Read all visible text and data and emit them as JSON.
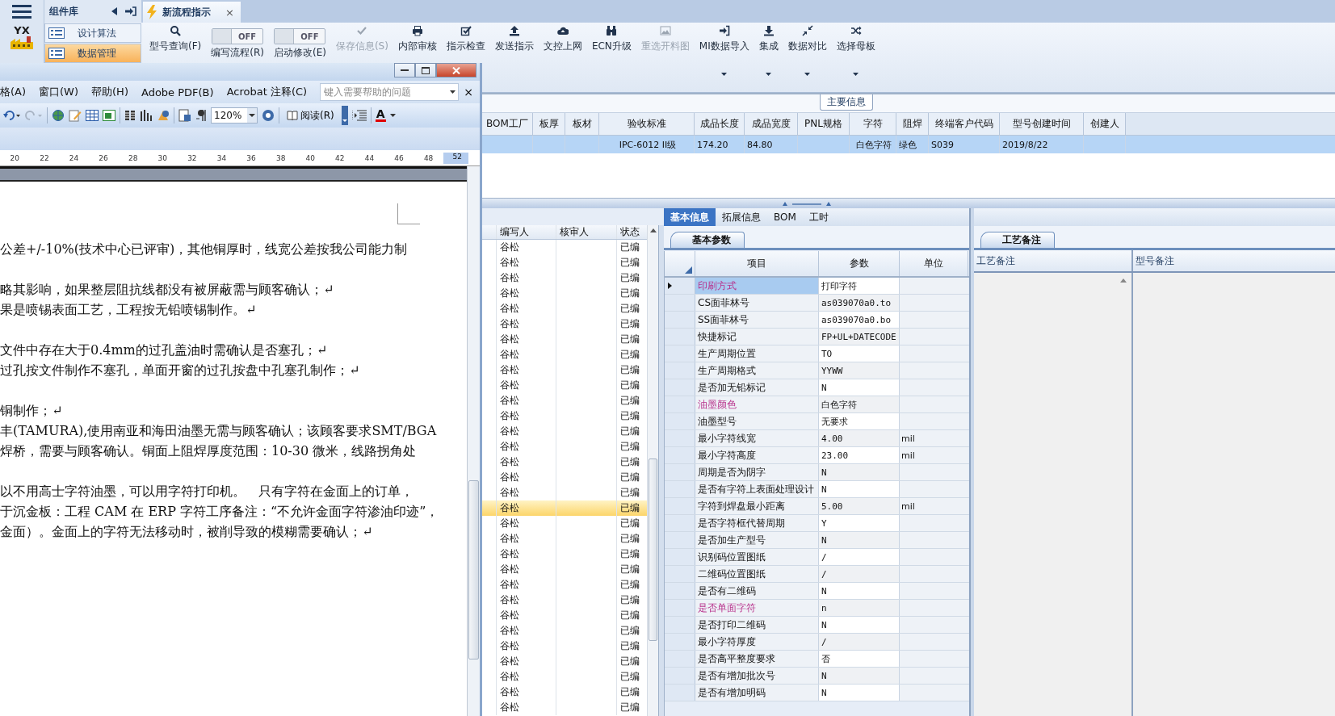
{
  "left_nav": {
    "logo_text": "YX"
  },
  "component_sidebar": {
    "title": "组件库",
    "items": [
      {
        "label": "设计算法",
        "selected": false
      },
      {
        "label": "数据管理",
        "selected": true
      }
    ]
  },
  "document_tabs": [
    {
      "title": "新流程指示",
      "close": "×",
      "selected": true
    }
  ],
  "ribbon": [
    {
      "kind": "button",
      "label": "型号查询(F)",
      "disabled": false,
      "dropdown": false
    },
    {
      "kind": "toggle",
      "label": "编写流程(R)",
      "state_text": "OFF",
      "on": false
    },
    {
      "kind": "toggle",
      "label": "启动修改(E)",
      "state_text": "OFF",
      "on": false
    },
    {
      "kind": "button",
      "label": "保存信息(S)",
      "disabled": true,
      "dropdown": false
    },
    {
      "kind": "button",
      "label": "内部审核",
      "disabled": false,
      "dropdown": false
    },
    {
      "kind": "button",
      "label": "指示检查",
      "disabled": false,
      "dropdown": false
    },
    {
      "kind": "button",
      "label": "发送指示",
      "disabled": false,
      "dropdown": false
    },
    {
      "kind": "button",
      "label": "文控上网",
      "disabled": false,
      "dropdown": false
    },
    {
      "kind": "button",
      "label": "ECN升级",
      "disabled": false,
      "dropdown": false
    },
    {
      "kind": "button",
      "label": "重选开料图",
      "disabled": true,
      "dropdown": false
    },
    {
      "kind": "button",
      "label": "MI数据导入",
      "disabled": false,
      "dropdown": true
    },
    {
      "kind": "button",
      "label": "集成",
      "disabled": false,
      "dropdown": true
    },
    {
      "kind": "button",
      "label": "数据对比",
      "disabled": false,
      "dropdown": true
    },
    {
      "kind": "button",
      "label": "选择母板",
      "disabled": false,
      "dropdown": true
    }
  ],
  "main_group": {
    "title": "主要信息"
  },
  "main_table": {
    "row_selected": true,
    "columns": [
      {
        "label": "BOM工厂"
      },
      {
        "label": "板厚"
      },
      {
        "label": "板材"
      },
      {
        "label": "验收标准",
        "value": "IPC-6012 II级"
      },
      {
        "label": "成品长度",
        "value": "174.20"
      },
      {
        "label": "成品宽度",
        "value": "84.80"
      },
      {
        "label": "PNL规格"
      },
      {
        "label": "字符",
        "value": "白色字符"
      },
      {
        "label": "阻焊",
        "value": "绿色"
      },
      {
        "label": "终端客户代码",
        "value": "S039"
      },
      {
        "label": "型号创建时间",
        "value": "2019/8/22"
      },
      {
        "label": "创建人"
      }
    ]
  },
  "detail_list": {
    "columns": [
      "编写人",
      "核审人",
      "状态"
    ],
    "rows": [
      {
        "writer": "谷松",
        "status": "已编",
        "selected": false
      },
      {
        "writer": "谷松",
        "status": "已编",
        "selected": false
      },
      {
        "writer": "谷松",
        "status": "已编",
        "selected": false
      },
      {
        "writer": "谷松",
        "status": "已编",
        "selected": false
      },
      {
        "writer": "谷松",
        "status": "已编",
        "selected": false
      },
      {
        "writer": "谷松",
        "status": "已编",
        "selected": false
      },
      {
        "writer": "谷松",
        "status": "已编",
        "selected": false
      },
      {
        "writer": "谷松",
        "status": "已编",
        "selected": false
      },
      {
        "writer": "谷松",
        "status": "已编",
        "selected": false
      },
      {
        "writer": "谷松",
        "status": "已编",
        "selected": false
      },
      {
        "writer": "谷松",
        "status": "已编",
        "selected": false
      },
      {
        "writer": "谷松",
        "status": "已编",
        "selected": false
      },
      {
        "writer": "谷松",
        "status": "已编",
        "selected": false
      },
      {
        "writer": "谷松",
        "status": "已编",
        "selected": false
      },
      {
        "writer": "谷松",
        "status": "已编",
        "selected": false
      },
      {
        "writer": "谷松",
        "status": "已编",
        "selected": false
      },
      {
        "writer": "谷松",
        "status": "已编",
        "selected": false
      },
      {
        "writer": "谷松",
        "status": "已编",
        "selected": true
      },
      {
        "writer": "谷松",
        "status": "已编",
        "selected": false
      },
      {
        "writer": "谷松",
        "status": "已编",
        "selected": false
      },
      {
        "writer": "谷松",
        "status": "已编",
        "selected": false
      },
      {
        "writer": "谷松",
        "status": "已编",
        "selected": false
      },
      {
        "writer": "谷松",
        "status": "已编",
        "selected": false
      },
      {
        "writer": "谷松",
        "status": "已编",
        "selected": false
      },
      {
        "writer": "谷松",
        "status": "已编",
        "selected": false
      },
      {
        "writer": "谷松",
        "status": "已编",
        "selected": false
      },
      {
        "writer": "谷松",
        "status": "已编",
        "selected": false
      },
      {
        "writer": "谷松",
        "status": "已编",
        "selected": false
      },
      {
        "writer": "谷松",
        "status": "已编",
        "selected": false
      },
      {
        "writer": "谷松",
        "status": "已编",
        "selected": false
      },
      {
        "writer": "谷松",
        "status": "已编",
        "selected": false
      }
    ]
  },
  "properties_panel": {
    "tabs": [
      {
        "label": "基本信息",
        "selected": true
      },
      {
        "label": "拓展信息",
        "selected": false
      },
      {
        "label": "BOM",
        "selected": false
      },
      {
        "label": "工时",
        "selected": false
      }
    ],
    "subtab": {
      "label": "基本参数",
      "selected": true
    },
    "columns": [
      "项目",
      "参数",
      "单位"
    ],
    "rows": [
      {
        "item": "印刷方式",
        "value": "打印字符",
        "flagged": true,
        "selected": true
      },
      {
        "item": "CS面菲林号",
        "value": "as039070a0.to",
        "flagged": false,
        "selected": false
      },
      {
        "item": "SS面菲林号",
        "value": "as039070a0.bo",
        "flagged": false,
        "selected": false
      },
      {
        "item": "快捷标记",
        "value": "FP+UL+DATECODE",
        "flagged": false,
        "selected": false
      },
      {
        "item": "生产周期位置",
        "value": "TO",
        "flagged": false,
        "selected": false
      },
      {
        "item": "生产周期格式",
        "value": "YYWW",
        "flagged": false,
        "selected": false
      },
      {
        "item": "是否加无铅标记",
        "value": "N",
        "flagged": false,
        "selected": false
      },
      {
        "item": "油墨颜色",
        "value": "白色字符",
        "flagged": true,
        "selected": false
      },
      {
        "item": "油墨型号",
        "value": "无要求",
        "flagged": false,
        "selected": false
      },
      {
        "item": "最小字符线宽",
        "value": "4.00",
        "unit": "mil",
        "flagged": false,
        "selected": false
      },
      {
        "item": "最小字符高度",
        "value": "23.00",
        "unit": "mil",
        "flagged": false,
        "selected": false
      },
      {
        "item": "周期是否为阴字",
        "value": "N",
        "flagged": false,
        "selected": false
      },
      {
        "item": "是否有字符上表面处理设计",
        "value": "N",
        "flagged": false,
        "selected": false
      },
      {
        "item": "字符到焊盘最小距离",
        "value": "5.00",
        "unit": "mil",
        "flagged": false,
        "selected": false
      },
      {
        "item": "是否字符框代替周期",
        "value": "Y",
        "flagged": false,
        "selected": false
      },
      {
        "item": "是否加生产型号",
        "value": "N",
        "flagged": false,
        "selected": false
      },
      {
        "item": "识别码位置图纸",
        "value": "/",
        "flagged": false,
        "selected": false
      },
      {
        "item": "二维码位置图纸",
        "value": "/",
        "flagged": false,
        "selected": false
      },
      {
        "item": "是否有二维码",
        "value": "N",
        "flagged": false,
        "selected": false
      },
      {
        "item": "是否单面字符",
        "value": "n",
        "flagged": true,
        "selected": false
      },
      {
        "item": "是否打印二维码",
        "value": "N",
        "flagged": false,
        "selected": false
      },
      {
        "item": "最小字符厚度",
        "value": "/",
        "flagged": false,
        "selected": false
      },
      {
        "item": "是否高平整度要求",
        "value": "否",
        "flagged": false,
        "selected": false
      },
      {
        "item": "是否有增加批次号",
        "value": "N",
        "flagged": false,
        "selected": false
      },
      {
        "item": "是否有增加明码",
        "value": "N",
        "flagged": false,
        "selected": false
      }
    ]
  },
  "notes_panel": {
    "subtab": {
      "label": "工艺备注",
      "selected": true
    },
    "columns": [
      "工艺备注",
      "型号备注"
    ]
  },
  "word_window": {
    "menus": [
      "格(A)",
      "窗口(W)",
      "帮助(H)",
      "Adobe PDF(B)",
      "Acrobat 注释(C)"
    ],
    "help_box": {
      "placeholder": "键入需要帮助的问题"
    },
    "help_close": "×",
    "zoom": "120%",
    "read_button": "阅读(R)",
    "font_color_glyph": "A",
    "ruler": [
      "20",
      "22",
      "24",
      "26",
      "28",
      "30",
      "32",
      "34",
      "36",
      "38",
      "40",
      "42",
      "44",
      "46",
      "48"
    ],
    "ruler_margin_label": "52",
    "paragraphs": [
      [
        "公差+/-10%(技术中心已评审)，其他铜厚时，线宽公差按我公司能力制"
      ],
      [
        "略其影响，如果整层阻抗线都没有被屏蔽需与顾客确认；↵",
        " 果是喷锡表面工艺，工程按无铅喷锡制作。↵"
      ],
      [
        " 文件中存在大于0.4mm的过孔盖油时需确认是否塞孔；↵",
        "过孔按文件制作不塞孔，单面开窗的过孔按盘中孔塞孔制作；↵"
      ],
      [
        "铜制作；↵",
        "丰(TAMURA),使用南亚和海田油墨无需与顾客确认；该顾客要求SMT/BGA",
        "焊桥，需要与顾客确认。铜面上阻焊厚度范围：10-30 微米，线路拐角处"
      ],
      [
        "以不用高士字符油墨，可以用字符打印机。　只有字符在金面上的订单，",
        "于沉金板：工程 CAM 在 ERP 字符工序备注：“不允许金面字符渗油印迹”，",
        "金面）。金面上的字符无法移动时，被削导致的模糊需要确认；↵"
      ]
    ]
  }
}
